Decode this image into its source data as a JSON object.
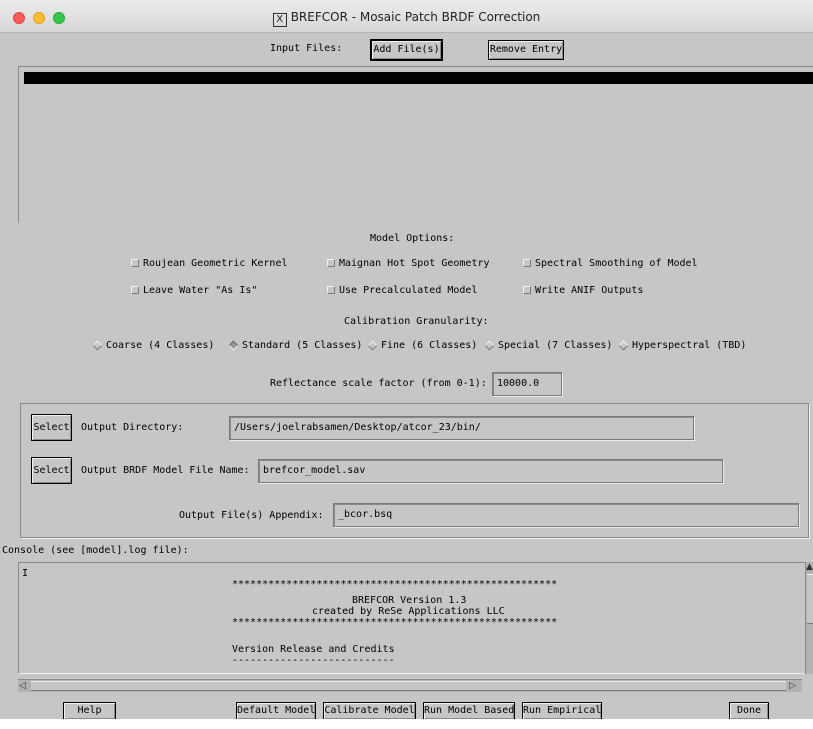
{
  "window": {
    "title": "BREFCOR - Mosaic Patch BRDF Correction",
    "title_icon": "x11-icon"
  },
  "input_files": {
    "label": "Input Files:",
    "add_button": "Add File(s)",
    "remove_button": "Remove Entry"
  },
  "model_options": {
    "heading": "Model Options:",
    "checkboxes": [
      {
        "label": "Roujean Geometric Kernel",
        "checked": false
      },
      {
        "label": "Maignan Hot Spot Geometry",
        "checked": false
      },
      {
        "label": "Spectral Smoothing of Model",
        "checked": false
      },
      {
        "label": "Leave Water \"As Is\"",
        "checked": false
      },
      {
        "label": "Use Precalculated Model",
        "checked": false
      },
      {
        "label": "Write ANIF Outputs",
        "checked": false
      }
    ]
  },
  "granularity": {
    "heading": "Calibration Granularity:",
    "options": [
      {
        "label": "Coarse (4 Classes)",
        "selected": false
      },
      {
        "label": "Standard (5 Classes)",
        "selected": true
      },
      {
        "label": "Fine (6 Classes)",
        "selected": false
      },
      {
        "label": "Special (7 Classes)",
        "selected": false
      },
      {
        "label": "Hyperspectral (TBD)",
        "selected": false
      }
    ]
  },
  "scale": {
    "label": "Reflectance scale factor (from 0-1):",
    "value": "10000.0"
  },
  "output": {
    "select_label": "Select",
    "dir_label": "Output Directory:",
    "dir_value": "/Users/joelrabsamen/Desktop/atcor_23/bin/",
    "model_label": "Output BRDF Model File Name:",
    "model_value": "brefcor_model.sav",
    "appendix_label": "Output File(s) Appendix:",
    "appendix_value": "_bcor.bsq"
  },
  "console": {
    "label": "Console (see [model].log file):",
    "lines": [
      "******************************************************",
      "BREFCOR Version 1.3",
      "created by ReSe Applications LLC",
      "******************************************************",
      "",
      "Version Release and Credits",
      "---------------------------"
    ]
  },
  "buttons": {
    "help": "Help",
    "default_model": "Default Model",
    "calibrate_model": "Calibrate Model",
    "run_model_based": "Run Model Based",
    "run_empirical": "Run Empirical",
    "done": "Done"
  },
  "colors": {
    "background": "#c6c6c6",
    "close": "#fc5b57",
    "minimize": "#fdbc2e",
    "zoom": "#34c748"
  }
}
